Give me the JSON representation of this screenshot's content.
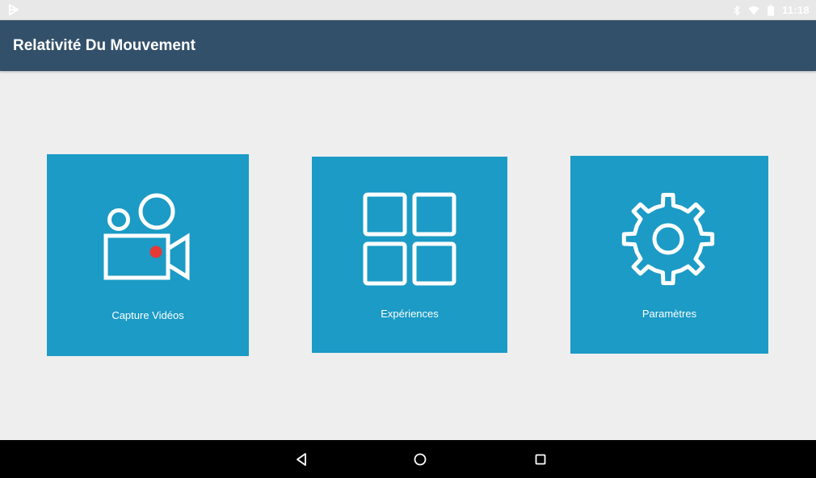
{
  "status_bar": {
    "time": "11:18",
    "icons": [
      "app-notification-icon",
      "bluetooth-icon",
      "wifi-icon",
      "battery-icon"
    ]
  },
  "app_bar": {
    "title": "Relativité Du Mouvement"
  },
  "tiles": [
    {
      "label": "Capture Vidéos",
      "icon": "video-camera-icon"
    },
    {
      "label": "Expériences",
      "icon": "grid-icon"
    },
    {
      "label": "Paramètres",
      "icon": "gear-icon"
    }
  ],
  "nav_bar": {
    "icons": [
      "back-icon",
      "home-icon",
      "recents-icon"
    ]
  },
  "colors": {
    "app_bar": "#33506a",
    "tile": "#1b9bc6",
    "record_dot": "#e53935",
    "background": "#eeeeee",
    "nav_bar": "#000000"
  }
}
